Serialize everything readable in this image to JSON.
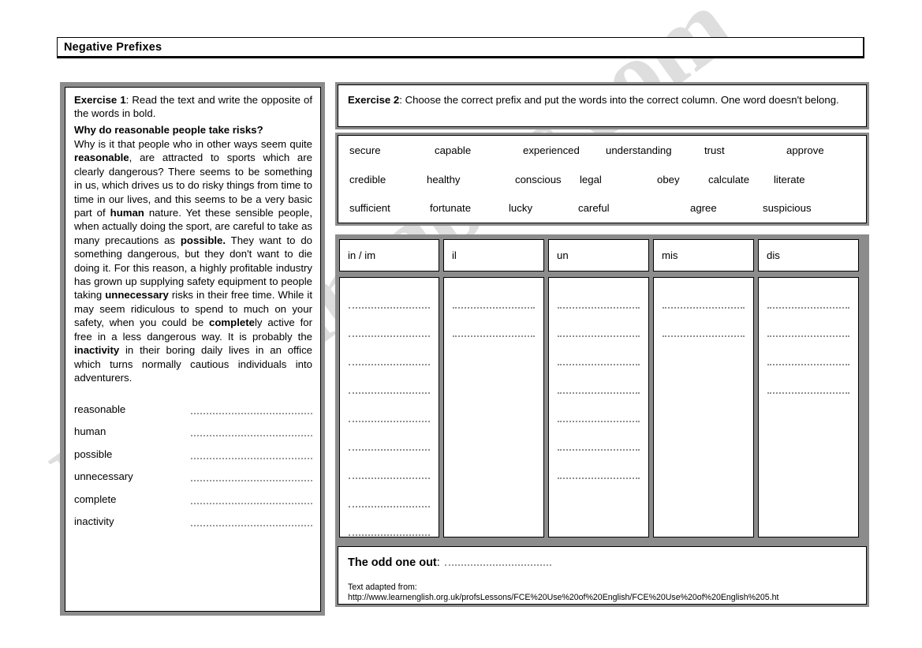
{
  "title_bar": {
    "title": "Negative Prefixes"
  },
  "exercise1": {
    "label": "Exercise 1",
    "instruction": ": Read the text and write the opposite of the words in bold.",
    "text_heading": "Why do reasonable people take risks?",
    "text_parts": [
      {
        "t": "Why is it that people who in other ways seem quite ",
        "b": false
      },
      {
        "t": "reasonable",
        "b": true
      },
      {
        "t": ", are attracted to sports which are clearly dangerous? There seems to be something in us, which drives us to do risky things from time to time in our lives, and this seems to be a very basic part of ",
        "b": false
      },
      {
        "t": "human",
        "b": true
      },
      {
        "t": " nature. Yet these sensible people, when actually doing the sport, are careful to take as many precautions as ",
        "b": false
      },
      {
        "t": "possible.",
        "b": true
      },
      {
        "t": " They want to do something dangerous, but they don't want to die doing it. For this reason, a highly profitable industry has grown up supplying safety equipment to people taking ",
        "b": false
      },
      {
        "t": "unnecessary",
        "b": true
      },
      {
        "t": " risks in their free time. While it may seem ridiculous to spend to much on your safety, when you could be ",
        "b": false
      },
      {
        "t": "complete",
        "b": true
      },
      {
        "t": "ly active for free in a less dangerous way. It is probably the ",
        "b": false
      },
      {
        "t": "inactivity",
        "b": true
      },
      {
        "t": " in their boring daily lives in an office which turns normally cautious individuals into adventurers.",
        "b": false
      }
    ],
    "answer_words": [
      "reasonable",
      "human",
      "possible",
      "unnecessary",
      "complete",
      "inactivity"
    ]
  },
  "exercise2": {
    "label": "Exercise 2",
    "instruction": ": Choose the correct prefix and put the words into the correct column. One word doesn't belong.",
    "word_bank_rows": [
      [
        "secure",
        "capable",
        "experienced",
        "understanding",
        "trust",
        "approve"
      ],
      [
        "credible",
        "healthy",
        "conscious",
        "legal",
        "obey",
        "calculate",
        "literate"
      ],
      [
        "sufficient",
        "fortunate",
        "lucky",
        "careful",
        "agree",
        "suspicious"
      ]
    ],
    "prefix_columns": [
      {
        "header": "in / im",
        "blank_lines": 10
      },
      {
        "header": "il",
        "blank_lines": 2
      },
      {
        "header": "un",
        "blank_lines": 7
      },
      {
        "header": "mis",
        "blank_lines": 2
      },
      {
        "header": "dis",
        "blank_lines": 4
      }
    ],
    "odd_one_out_label": "The odd one out",
    "odd_one_out_colon": ":",
    "source_label": "Text adapted from:",
    "source_url": "http://www.learnenglish.org.uk/profsLessons/FCE%20Use%20of%20English/FCE%20Use%20of%20English%205.ht"
  },
  "watermark": {
    "text": "ESLprintables.com"
  },
  "colors": {
    "frame_gray": "#8c8c8c",
    "line_gray": "#9a9a9a",
    "ink": "#000000",
    "page": "#ffffff"
  }
}
